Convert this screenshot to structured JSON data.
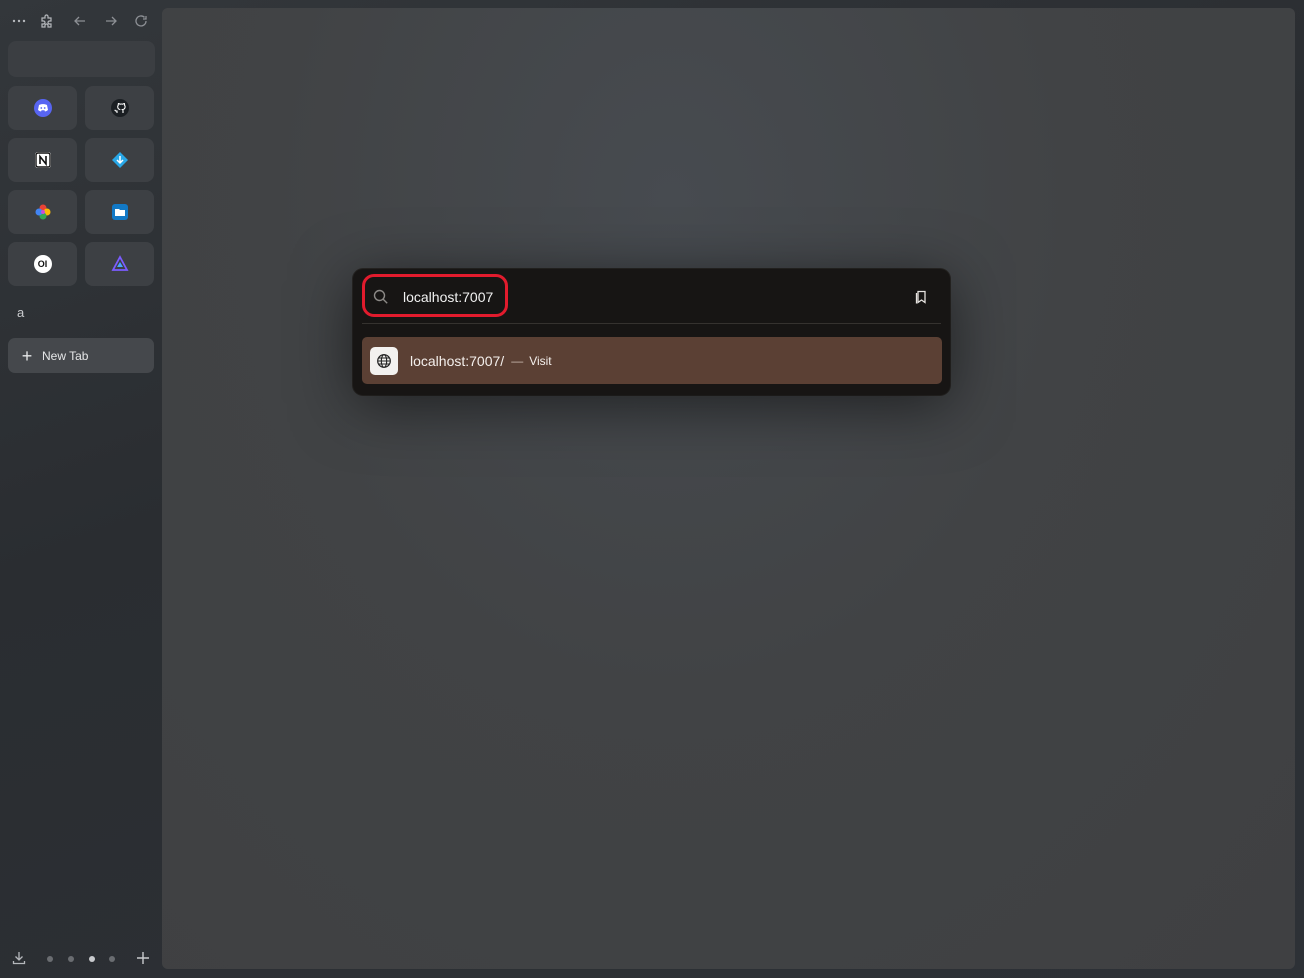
{
  "sidebar": {
    "toolbar": {
      "menu_icon": "more-horizontal-icon",
      "extensions_icon": "puzzle-icon",
      "back_icon": "arrow-left-icon",
      "forward_icon": "arrow-right-icon",
      "reload_icon": "reload-icon"
    },
    "pinned": [
      {
        "name": "discord",
        "icon": "discord-icon",
        "color": "#5865f2"
      },
      {
        "name": "github",
        "icon": "github-icon",
        "color": "#1b1f23"
      },
      {
        "name": "notion",
        "icon": "notion-icon",
        "color": "#ffffff"
      },
      {
        "name": "app-blue",
        "icon": "blue-app-icon",
        "color": "#29a8e8"
      },
      {
        "name": "photos",
        "icon": "pinwheel-icon",
        "color": "#ea4335"
      },
      {
        "name": "files",
        "icon": "folder-icon",
        "color": "#1279c6"
      },
      {
        "name": "openwebui",
        "icon": "oi-icon",
        "color": "#ffffff",
        "text": "OI"
      },
      {
        "name": "triangle-app",
        "icon": "triangle-icon",
        "color": "#7b5cff"
      }
    ],
    "space_label": "a",
    "new_tab_label": "New Tab"
  },
  "palette": {
    "query": "localhost:7007",
    "result": {
      "url": "localhost:7007/",
      "separator": "—",
      "action": "Visit"
    }
  },
  "colors": {
    "highlight": "#e21b2d",
    "result_bg": "#5b4034",
    "palette_bg": "#171514"
  }
}
